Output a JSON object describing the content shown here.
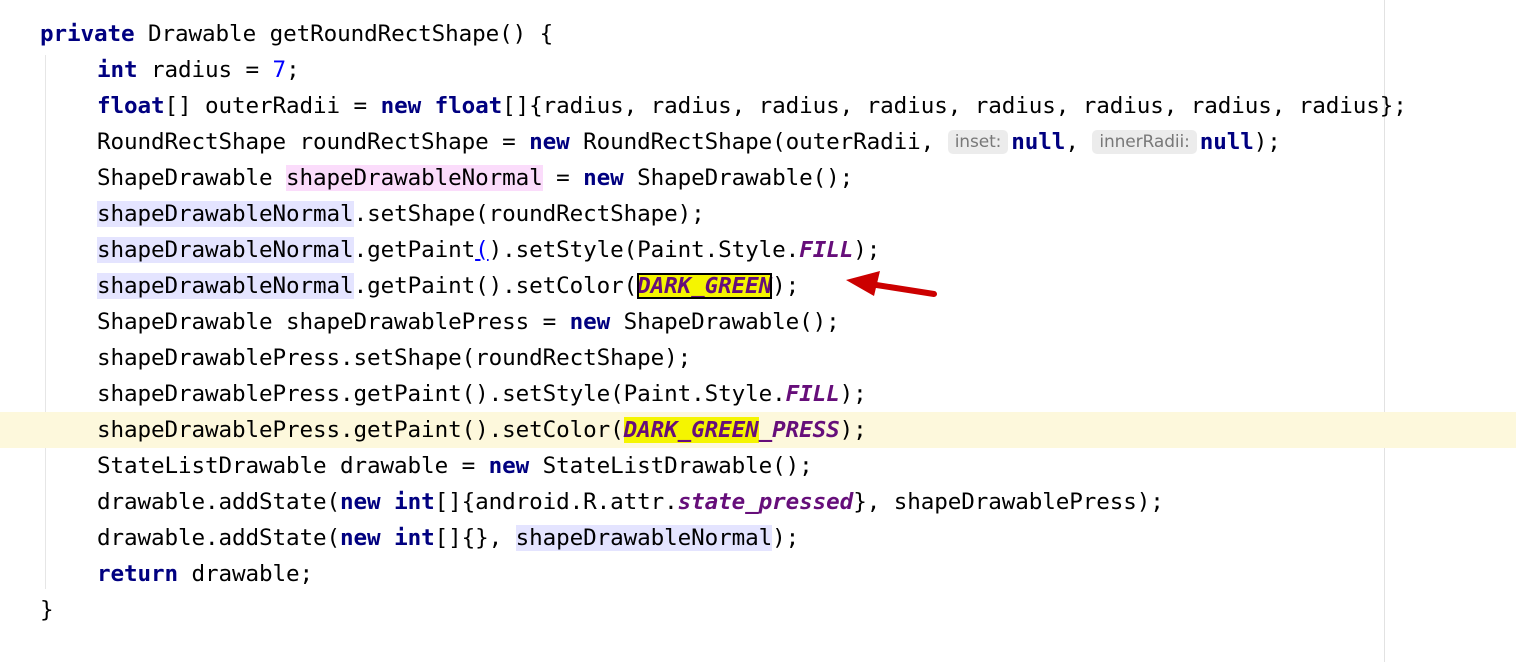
{
  "editor": {
    "signature": {
      "modifier": "private",
      "type": "Drawable",
      "rest": " getRoundRectShape() {"
    },
    "l2": {
      "kw": "int",
      "a": " radius = ",
      "num": "7",
      "b": ";"
    },
    "l3": {
      "kw1": "float",
      "a": "[] outerRadii = ",
      "kw2": "new",
      "sp": " ",
      "kw3": "float",
      "b": "[]{radius, radius, radius, radius, radius, radius, radius, radius};"
    },
    "l4": {
      "a": "RoundRectShape roundRectShape = ",
      "kw": "new",
      "b": " RoundRectShape(outerRadii, ",
      "hint1": "inset:",
      "null1": "null",
      "c": ", ",
      "hint2": "innerRadii:",
      "null2": "null",
      "d": ");"
    },
    "l5": {
      "a": "ShapeDrawable ",
      "var": "shapeDrawableNormal",
      "b": " = ",
      "kw": "new",
      "c": " ShapeDrawable();"
    },
    "l6": {
      "var": "shapeDrawableNormal",
      "a": ".setShape(roundRectShape);"
    },
    "l7": {
      "var": "shapeDrawableNormal",
      "a": ".getPaint",
      "paren_open": "(",
      "paren_close": ")",
      "b": ".setStyle(Paint.Style.",
      "const": "FILL",
      "c": ");"
    },
    "l8": {
      "var": "shapeDrawableNormal",
      "a": ".getPaint().setColor(",
      "const": "DARK_GREEN",
      "b": ");"
    },
    "l9": {
      "a": "ShapeDrawable shapeDrawablePress = ",
      "kw": "new",
      "b": " ShapeDrawable();"
    },
    "l10": {
      "a": "shapeDrawablePress.setShape(roundRectShape);"
    },
    "l11": {
      "a": "shapeDrawablePress.getPaint().setStyle(Paint.Style.",
      "const": "FILL",
      "b": ");"
    },
    "l12": {
      "a": "shapeDrawablePress.getPaint().setColor(",
      "const_match": "DARK_GREEN",
      "const_rest": "_PRESS",
      "b": ");"
    },
    "l13": {
      "a": "StateListDrawable drawable = ",
      "kw": "new",
      "b": " StateListDrawable();"
    },
    "l14": {
      "a": "drawable.addState(",
      "kw1": "new",
      "sp": " ",
      "kw2": "int",
      "b": "[]{android.R.attr.",
      "const": "state_pressed",
      "c": "}, shapeDrawablePress);"
    },
    "l15": {
      "a": "drawable.addState(",
      "kw1": "new",
      "sp": " ",
      "kw2": "int",
      "b": "[]{}, ",
      "var": "shapeDrawableNormal",
      "c": ");"
    },
    "l16": {
      "kw": "return",
      "a": " drawable;"
    },
    "l17": {
      "a": "}"
    }
  },
  "colors": {
    "keyword": "#000080",
    "number": "#0000ff",
    "constant": "#660e7a",
    "read_highlight": "#e4e4ff",
    "write_highlight": "#fbdcfb",
    "search_match": "#f5f500",
    "current_line": "#fdf8dc",
    "annotation_arrow": "#cc0000"
  },
  "icons": {
    "annotation": "red-arrow-icon"
  }
}
